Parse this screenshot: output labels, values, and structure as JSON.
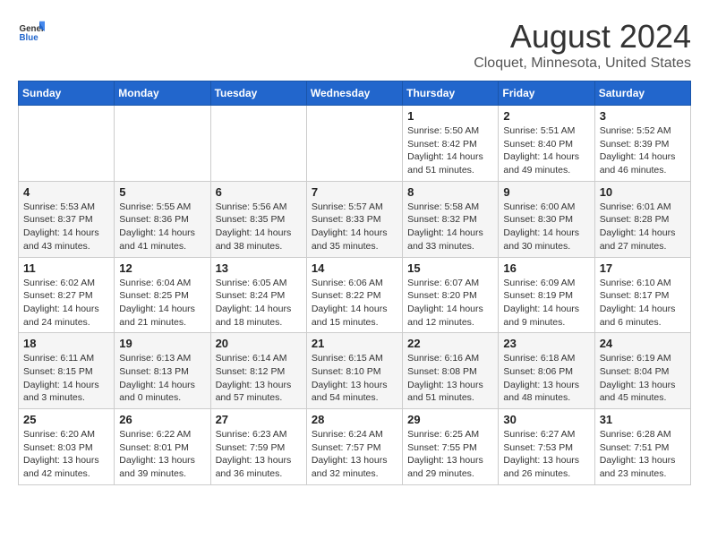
{
  "header": {
    "logo_general": "General",
    "logo_blue": "Blue",
    "main_title": "August 2024",
    "subtitle": "Cloquet, Minnesota, United States"
  },
  "days_of_week": [
    "Sunday",
    "Monday",
    "Tuesday",
    "Wednesday",
    "Thursday",
    "Friday",
    "Saturday"
  ],
  "weeks": [
    [
      {
        "day": "",
        "info": ""
      },
      {
        "day": "",
        "info": ""
      },
      {
        "day": "",
        "info": ""
      },
      {
        "day": "",
        "info": ""
      },
      {
        "day": "1",
        "info": "Sunrise: 5:50 AM\nSunset: 8:42 PM\nDaylight: 14 hours\nand 51 minutes."
      },
      {
        "day": "2",
        "info": "Sunrise: 5:51 AM\nSunset: 8:40 PM\nDaylight: 14 hours\nand 49 minutes."
      },
      {
        "day": "3",
        "info": "Sunrise: 5:52 AM\nSunset: 8:39 PM\nDaylight: 14 hours\nand 46 minutes."
      }
    ],
    [
      {
        "day": "4",
        "info": "Sunrise: 5:53 AM\nSunset: 8:37 PM\nDaylight: 14 hours\nand 43 minutes."
      },
      {
        "day": "5",
        "info": "Sunrise: 5:55 AM\nSunset: 8:36 PM\nDaylight: 14 hours\nand 41 minutes."
      },
      {
        "day": "6",
        "info": "Sunrise: 5:56 AM\nSunset: 8:35 PM\nDaylight: 14 hours\nand 38 minutes."
      },
      {
        "day": "7",
        "info": "Sunrise: 5:57 AM\nSunset: 8:33 PM\nDaylight: 14 hours\nand 35 minutes."
      },
      {
        "day": "8",
        "info": "Sunrise: 5:58 AM\nSunset: 8:32 PM\nDaylight: 14 hours\nand 33 minutes."
      },
      {
        "day": "9",
        "info": "Sunrise: 6:00 AM\nSunset: 8:30 PM\nDaylight: 14 hours\nand 30 minutes."
      },
      {
        "day": "10",
        "info": "Sunrise: 6:01 AM\nSunset: 8:28 PM\nDaylight: 14 hours\nand 27 minutes."
      }
    ],
    [
      {
        "day": "11",
        "info": "Sunrise: 6:02 AM\nSunset: 8:27 PM\nDaylight: 14 hours\nand 24 minutes."
      },
      {
        "day": "12",
        "info": "Sunrise: 6:04 AM\nSunset: 8:25 PM\nDaylight: 14 hours\nand 21 minutes."
      },
      {
        "day": "13",
        "info": "Sunrise: 6:05 AM\nSunset: 8:24 PM\nDaylight: 14 hours\nand 18 minutes."
      },
      {
        "day": "14",
        "info": "Sunrise: 6:06 AM\nSunset: 8:22 PM\nDaylight: 14 hours\nand 15 minutes."
      },
      {
        "day": "15",
        "info": "Sunrise: 6:07 AM\nSunset: 8:20 PM\nDaylight: 14 hours\nand 12 minutes."
      },
      {
        "day": "16",
        "info": "Sunrise: 6:09 AM\nSunset: 8:19 PM\nDaylight: 14 hours\nand 9 minutes."
      },
      {
        "day": "17",
        "info": "Sunrise: 6:10 AM\nSunset: 8:17 PM\nDaylight: 14 hours\nand 6 minutes."
      }
    ],
    [
      {
        "day": "18",
        "info": "Sunrise: 6:11 AM\nSunset: 8:15 PM\nDaylight: 14 hours\nand 3 minutes."
      },
      {
        "day": "19",
        "info": "Sunrise: 6:13 AM\nSunset: 8:13 PM\nDaylight: 14 hours\nand 0 minutes."
      },
      {
        "day": "20",
        "info": "Sunrise: 6:14 AM\nSunset: 8:12 PM\nDaylight: 13 hours\nand 57 minutes."
      },
      {
        "day": "21",
        "info": "Sunrise: 6:15 AM\nSunset: 8:10 PM\nDaylight: 13 hours\nand 54 minutes."
      },
      {
        "day": "22",
        "info": "Sunrise: 6:16 AM\nSunset: 8:08 PM\nDaylight: 13 hours\nand 51 minutes."
      },
      {
        "day": "23",
        "info": "Sunrise: 6:18 AM\nSunset: 8:06 PM\nDaylight: 13 hours\nand 48 minutes."
      },
      {
        "day": "24",
        "info": "Sunrise: 6:19 AM\nSunset: 8:04 PM\nDaylight: 13 hours\nand 45 minutes."
      }
    ],
    [
      {
        "day": "25",
        "info": "Sunrise: 6:20 AM\nSunset: 8:03 PM\nDaylight: 13 hours\nand 42 minutes."
      },
      {
        "day": "26",
        "info": "Sunrise: 6:22 AM\nSunset: 8:01 PM\nDaylight: 13 hours\nand 39 minutes."
      },
      {
        "day": "27",
        "info": "Sunrise: 6:23 AM\nSunset: 7:59 PM\nDaylight: 13 hours\nand 36 minutes."
      },
      {
        "day": "28",
        "info": "Sunrise: 6:24 AM\nSunset: 7:57 PM\nDaylight: 13 hours\nand 32 minutes."
      },
      {
        "day": "29",
        "info": "Sunrise: 6:25 AM\nSunset: 7:55 PM\nDaylight: 13 hours\nand 29 minutes."
      },
      {
        "day": "30",
        "info": "Sunrise: 6:27 AM\nSunset: 7:53 PM\nDaylight: 13 hours\nand 26 minutes."
      },
      {
        "day": "31",
        "info": "Sunrise: 6:28 AM\nSunset: 7:51 PM\nDaylight: 13 hours\nand 23 minutes."
      }
    ]
  ]
}
